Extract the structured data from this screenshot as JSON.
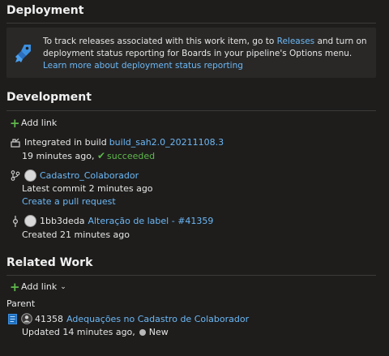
{
  "deployment": {
    "title": "Deployment",
    "info_before": "To track releases associated with this work item, go to ",
    "releases_link": "Releases",
    "info_after": " and turn on deployment status reporting for Boards in your pipeline's Options menu. ",
    "learn_more_link": "Learn more about deployment status reporting"
  },
  "development": {
    "title": "Development",
    "add_link_label": "Add link",
    "build": {
      "prefix": "Integrated in build ",
      "build_name": "build_sah2.0_20211108.3",
      "time": "19 minutes ago,",
      "status": "succeeded"
    },
    "branch": {
      "name": "Cadastro_Colaborador",
      "latest_commit": "Latest commit 2 minutes ago",
      "create_pr": "Create a pull request"
    },
    "commit": {
      "hash": "1bb3deda",
      "message": "Alteração de label - #41359",
      "created": "Created 21 minutes ago"
    }
  },
  "related_work": {
    "title": "Related Work",
    "add_link_label": "Add link",
    "parent_label": "Parent",
    "parent_item": {
      "id": "41358",
      "title": "Adequações no Cadastro de Colaborador",
      "updated": "Updated 14 minutes ago,",
      "state": "New"
    }
  },
  "colors": {
    "link": "#6cb8f6",
    "success": "#5fb84c",
    "background": "#1e1d1c",
    "info_box": "#292827"
  }
}
